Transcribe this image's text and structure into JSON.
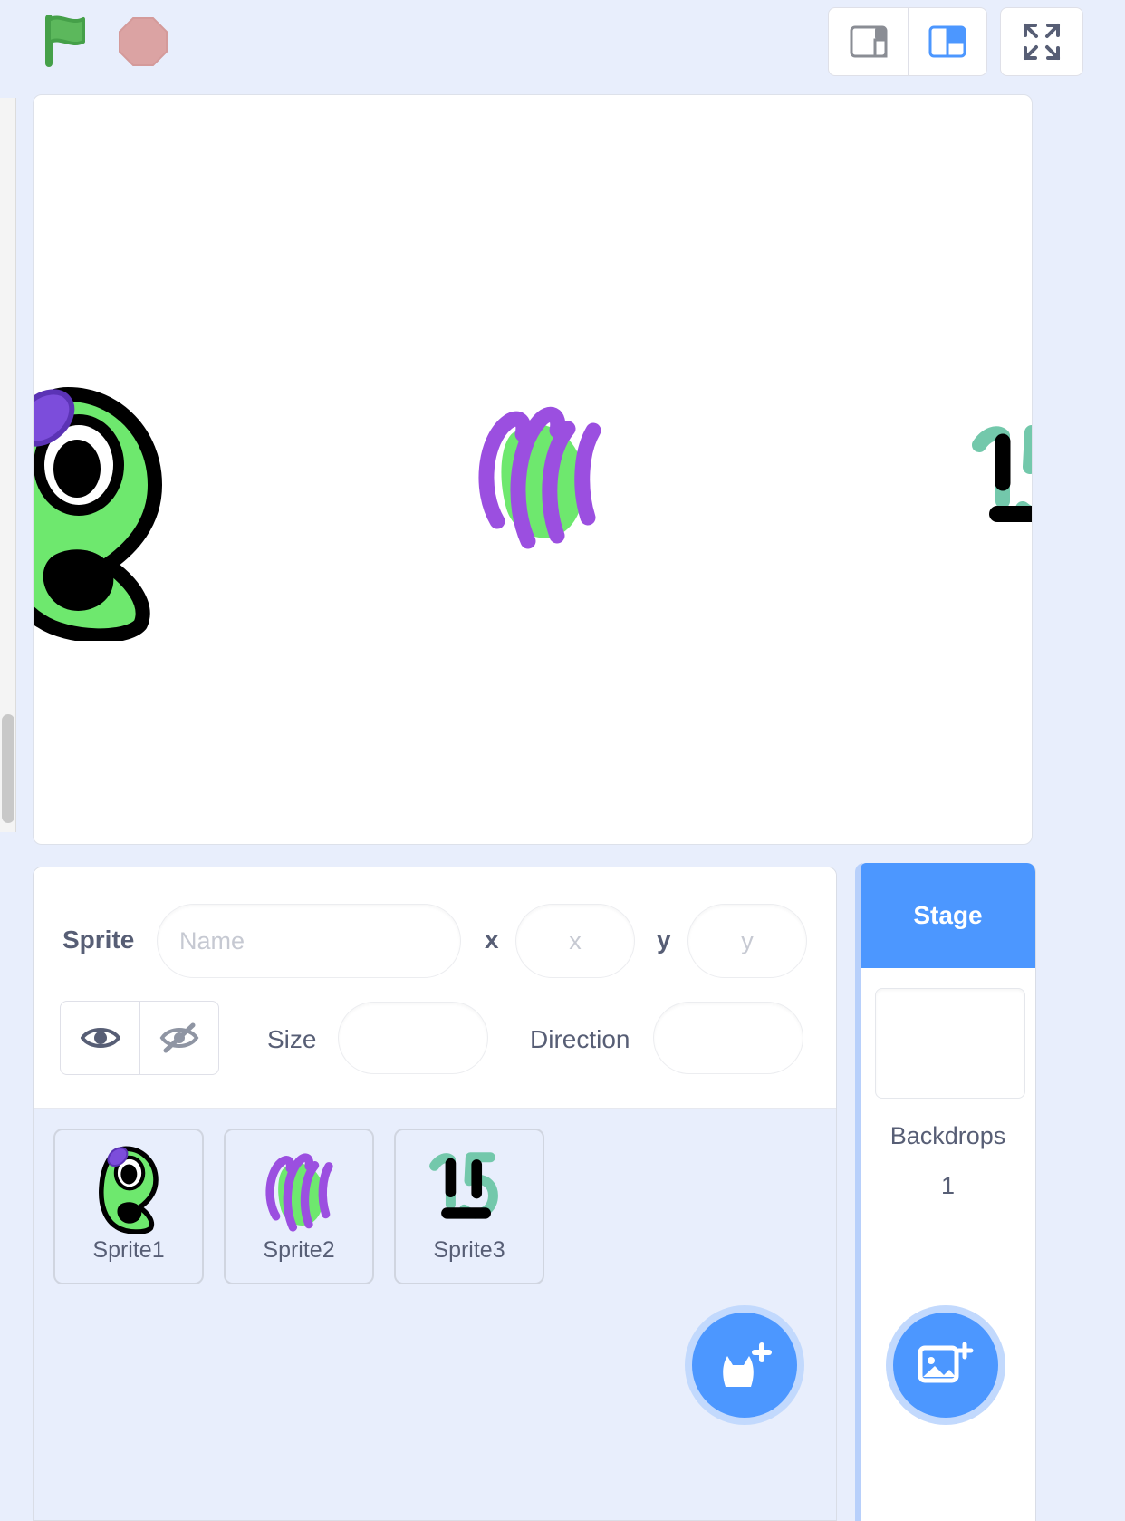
{
  "controls": {
    "green_flag_label": "Go",
    "stop_label": "Stop",
    "small_stage_label": "Small stage layout",
    "normal_stage_label": "Normal stage layout",
    "fullscreen_label": "Full screen control"
  },
  "colors": {
    "accent_blue": "#4c97ff",
    "page_bg": "#e8eefc",
    "flag_green": "#4cbf56",
    "stop_red": "#dba3a3",
    "text": "#575e75",
    "sprite_green": "#6ee86e",
    "sprite_purple": "#9b4fe0",
    "sprite_teal": "#73c8ab"
  },
  "sprite_info": {
    "sprite_label": "Sprite",
    "name_placeholder": "Name",
    "name_value": "",
    "x_label": "x",
    "x_placeholder": "x",
    "x_value": "",
    "y_label": "y",
    "y_placeholder": "y",
    "y_value": "",
    "show_label": "Show",
    "hide_label": "Hide",
    "size_label": "Size",
    "size_value": "",
    "direction_label": "Direction",
    "direction_value": ""
  },
  "sprites": [
    {
      "name": "Sprite1",
      "thumb": "blob-eye-sprite"
    },
    {
      "name": "Sprite2",
      "thumb": "swirl-sprite"
    },
    {
      "name": "Sprite3",
      "thumb": "face-15-sprite"
    }
  ],
  "stage_sprites": [
    {
      "name": "Sprite1",
      "thumb": "blob-eye-sprite"
    },
    {
      "name": "Sprite2",
      "thumb": "swirl-sprite"
    },
    {
      "name": "Sprite3",
      "thumb": "face-15-sprite"
    }
  ],
  "add_sprite": {
    "label": "Choose a Sprite",
    "icon": "cat-plus-icon"
  },
  "stage_pane": {
    "title": "Stage",
    "backdrops_label": "Backdrops",
    "backdrops_count": "1",
    "add_backdrop_label": "Choose a Backdrop",
    "add_backdrop_icon": "image-plus-icon"
  }
}
